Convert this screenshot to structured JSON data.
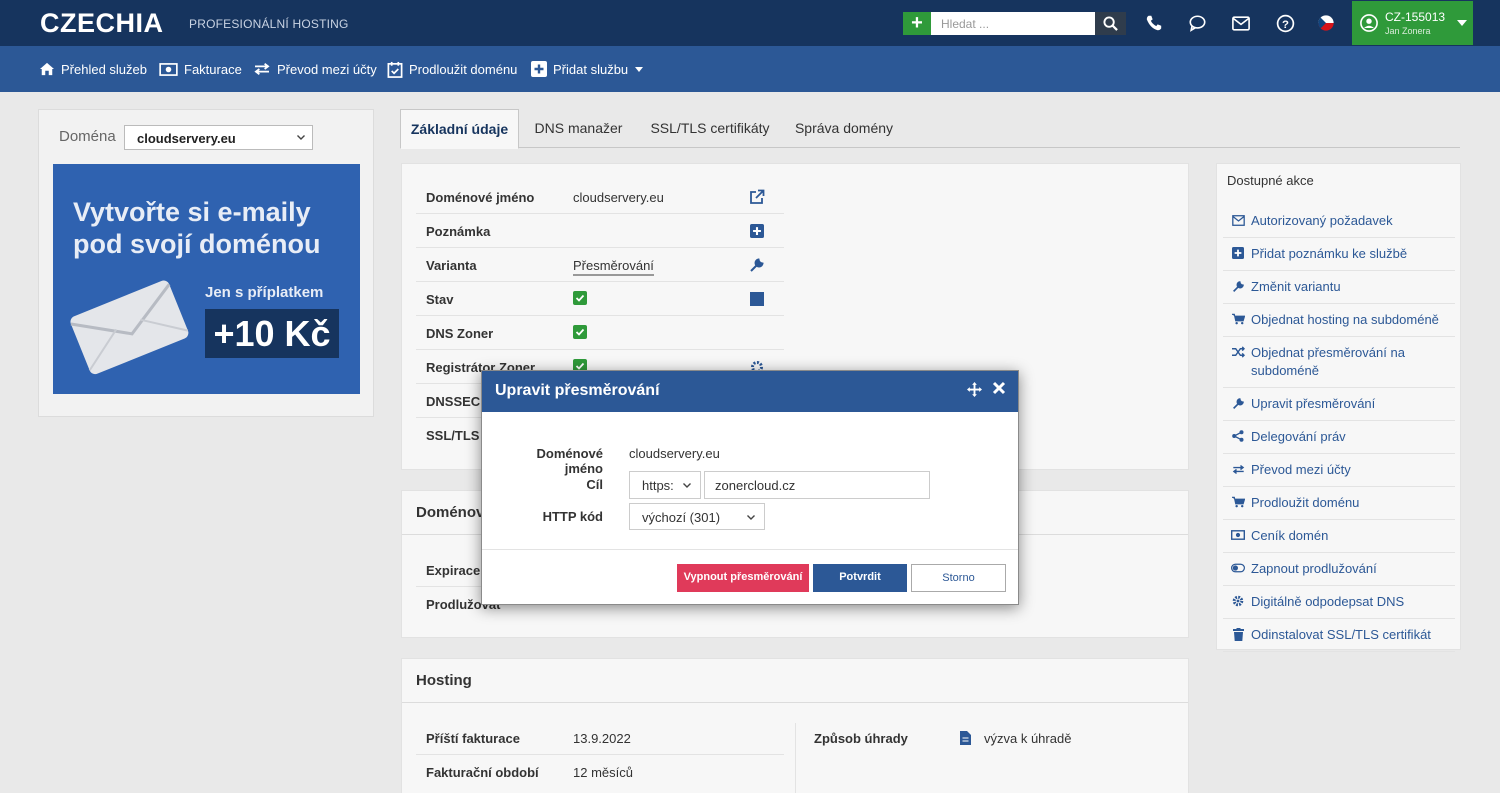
{
  "topbar": {
    "logo": "CZECHIA",
    "logo_sub": "PROFESIONÁLNÍ HOSTING",
    "search_placeholder": "Hledat ...",
    "account_id": "CZ-155013",
    "account_name": "Jan Zonera"
  },
  "nav": {
    "items": [
      {
        "label": "Přehled služeb",
        "icon": "home-icon"
      },
      {
        "label": "Fakturace",
        "icon": "money-icon"
      },
      {
        "label": "Převod mezi účty",
        "icon": "transfer-icon"
      },
      {
        "label": "Prodloužit doménu",
        "icon": "calendar-check-icon"
      },
      {
        "label": "Přidat službu",
        "icon": "plus-square-icon"
      }
    ]
  },
  "left": {
    "domain_label": "Doména",
    "domain_selected": "cloudservery.eu",
    "banner_title": "Vytvořte si e-maily pod svojí doménou",
    "banner_sub": "Jen s příplatkem",
    "banner_price": "+10 Kč"
  },
  "tabs": [
    "Základní údaje",
    "DNS manažer",
    "SSL/TLS certifikáty",
    "Správa domény"
  ],
  "main": {
    "rows": [
      {
        "label": "Doménové jméno",
        "value": "cloudservery.eu"
      },
      {
        "label": "Poznámka",
        "value": ""
      },
      {
        "label": "Varianta",
        "value": "Přesměrování"
      },
      {
        "label": "Stav",
        "value": ""
      },
      {
        "label": "DNS Zoner",
        "value": ""
      },
      {
        "label": "Registrátor Zoner",
        "value": ""
      },
      {
        "label": "DNSSEC Z",
        "value": ""
      },
      {
        "label": "SSL/TLS",
        "value": ""
      }
    ]
  },
  "domain_card": {
    "title": "Doménov",
    "rows": [
      {
        "label": "Expirace"
      },
      {
        "label": "Prodlužovat"
      }
    ]
  },
  "hosting": {
    "title": "Hosting",
    "rows": [
      {
        "label": "Příští fakturace",
        "value": "13.9.2022"
      },
      {
        "label": "Fakturační období",
        "value": "12 měsíců"
      }
    ],
    "payment_label": "Způsob úhrady",
    "payment_value": "výzva k úhradě"
  },
  "actions": {
    "title": "Dostupné akce",
    "items": [
      {
        "label": "Autorizovaný požadavek",
        "icon": "envelope-icon"
      },
      {
        "label": "Přidat poznámku ke službě",
        "icon": "plus-square-icon"
      },
      {
        "label": "Změnit variantu",
        "icon": "wrench-icon"
      },
      {
        "label": "Objednat hosting na subdoméně",
        "icon": "cart-icon"
      },
      {
        "label": "Objednat přesměrování na subdoméně",
        "icon": "shuffle-icon"
      },
      {
        "label": "Upravit přesměrování",
        "icon": "wrench-icon"
      },
      {
        "label": "Delegování práv",
        "icon": "share-icon"
      },
      {
        "label": "Převod mezi účty",
        "icon": "transfer-icon"
      },
      {
        "label": "Prodloužit doménu",
        "icon": "cart-icon"
      },
      {
        "label": "Ceník domén",
        "icon": "money-icon"
      },
      {
        "label": "Zapnout prodlužování",
        "icon": "toggle-icon"
      },
      {
        "label": "Digitálně odpodepsat DNS",
        "icon": "gear-icon"
      },
      {
        "label": "Odinstalovat SSL/TLS certifikát",
        "icon": "trash-icon"
      }
    ]
  },
  "modal": {
    "title": "Upravit přesměrování",
    "domain_label": "Doménové jméno",
    "domain_value": "cloudservery.eu",
    "target_label": "Cíl",
    "protocol": "https:",
    "target_value": "zonercloud.cz",
    "http_label": "HTTP kód",
    "http_value": "výchozí (301)",
    "btn_disable": "Vypnout přesměrování",
    "btn_confirm": "Potvrdit",
    "btn_cancel": "Storno"
  },
  "colors": {
    "topbar": "#16345e",
    "navbar": "#2c5896",
    "accent_green": "#2f9a3a",
    "danger": "#e03a5a"
  }
}
